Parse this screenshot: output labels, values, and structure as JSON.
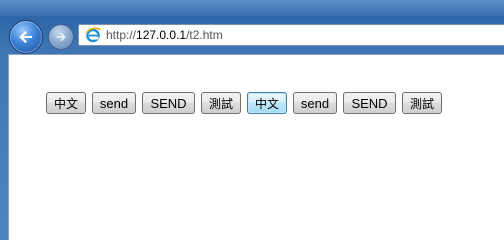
{
  "browser": {
    "address_bar": {
      "url_scheme": "http://",
      "url_host": "127.0.0.1",
      "url_path": "/t2.htm"
    },
    "icons": {
      "back": "back-arrow-icon",
      "forward": "forward-arrow-icon",
      "page": "internet-explorer-icon"
    },
    "colors": {
      "frame": "#3f77b4",
      "focused_button_border": "#3c7fb1"
    }
  },
  "page": {
    "buttons": [
      {
        "label": "中文",
        "focused": false
      },
      {
        "label": "send",
        "focused": false
      },
      {
        "label": "SEND",
        "focused": false
      },
      {
        "label": "測試",
        "focused": false
      },
      {
        "label": "中文",
        "focused": true
      },
      {
        "label": "send",
        "focused": false
      },
      {
        "label": "SEND",
        "focused": false
      },
      {
        "label": "測試",
        "focused": false
      }
    ]
  }
}
